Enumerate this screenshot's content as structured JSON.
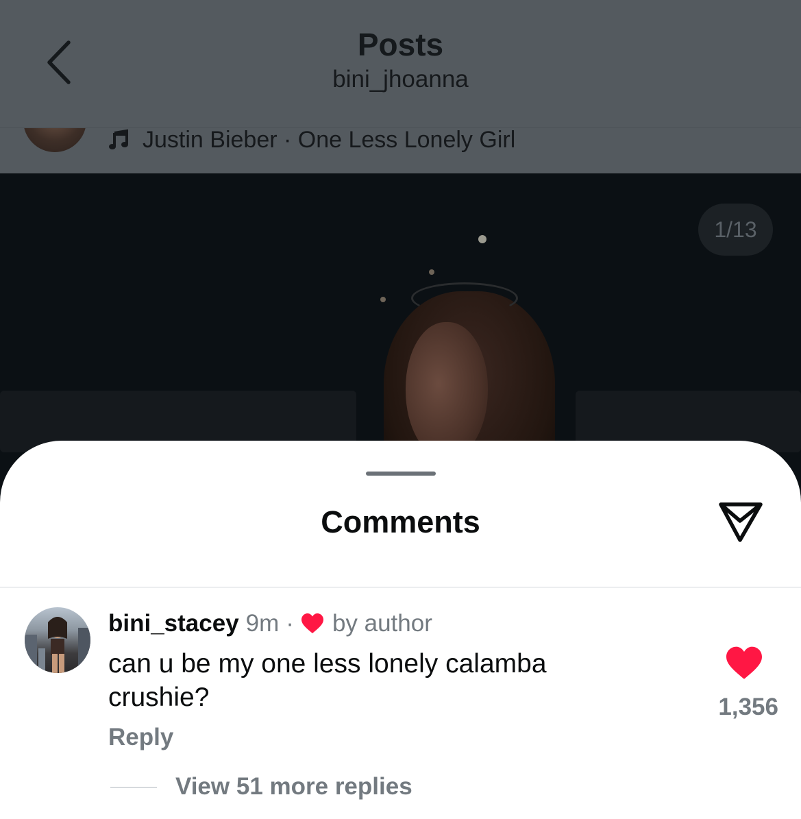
{
  "header": {
    "title": "Posts",
    "subtitle": "bini_jhoanna",
    "music": "Justin Bieber · One Less Lonely Girl"
  },
  "photo": {
    "counter": "1/13"
  },
  "sheet": {
    "title": "Comments"
  },
  "comment": {
    "username": "bini_stacey",
    "time": "9m",
    "separator": "·",
    "liked_by": "by author",
    "text": "can u be my one less lonely calamba crushie?",
    "reply_label": "Reply",
    "view_replies": "View 51 more replies",
    "likes": "1,356"
  },
  "colors": {
    "like_red": "#ff1744",
    "muted_text": "#737a80",
    "dim_overlay": "#545a5f"
  },
  "icons": [
    "back-chevron-icon",
    "music-note-icon",
    "share-send-icon",
    "heart-icon"
  ]
}
